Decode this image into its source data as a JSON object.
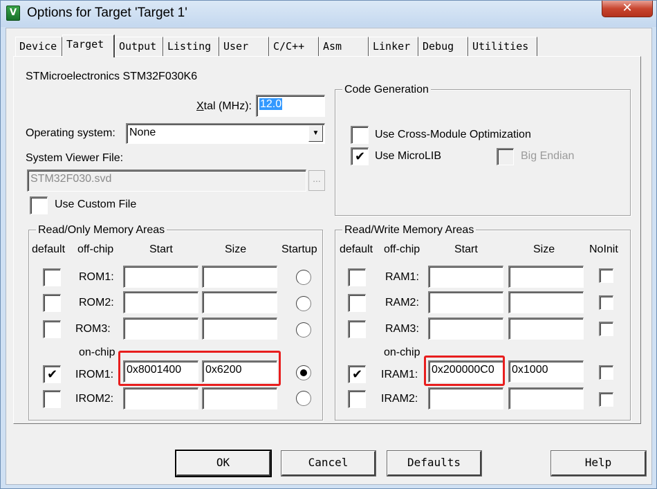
{
  "window": {
    "title": "Options for Target 'Target 1'",
    "icon": "keil-uvision-icon",
    "close_glyph": "✕"
  },
  "tabs": [
    {
      "label": "Device",
      "active": false
    },
    {
      "label": "Target",
      "active": true
    },
    {
      "label": "Output",
      "active": false
    },
    {
      "label": "Listing",
      "active": false
    },
    {
      "label": "User",
      "active": false
    },
    {
      "label": "C/C++",
      "active": false
    },
    {
      "label": "Asm",
      "active": false
    },
    {
      "label": "Linker",
      "active": false
    },
    {
      "label": "Debug",
      "active": false
    },
    {
      "label": "Utilities",
      "active": false
    }
  ],
  "device_name": "STMicroelectronics STM32F030K6",
  "xtal": {
    "label_pre": "",
    "label_u": "X",
    "label_post": "tal (MHz):",
    "value": "12.0"
  },
  "os": {
    "label": "Operating system:",
    "value": "None",
    "arrow": "▼"
  },
  "svd": {
    "label": "System Viewer File:",
    "value": "STM32F030.svd",
    "browse": "..."
  },
  "custom_file": {
    "label": "Use Custom File",
    "checked": false
  },
  "code_gen": {
    "title": "Code Generation",
    "cross_module": {
      "label": "Use Cross-Module Optimization",
      "checked": false
    },
    "microlib": {
      "label": "Use MicroLIB",
      "checked": true,
      "check_glyph": "✔"
    },
    "big_endian": {
      "label_pre": "Bi",
      "label_u": "g",
      "label_post": " Endian",
      "checked": false
    }
  },
  "ro": {
    "title": "Read/Only Memory Areas",
    "headers": {
      "default": "default",
      "offchip": "off-chip",
      "start": "Start",
      "size": "Size",
      "startup": "Startup"
    },
    "onchip_label": "on-chip",
    "rows": [
      {
        "name": "ROM1:",
        "default": false,
        "start": "",
        "size": "",
        "startup": false
      },
      {
        "name": "ROM2:",
        "default": false,
        "start": "",
        "size": "",
        "startup": false
      },
      {
        "name": "ROM3:",
        "default": false,
        "start": "",
        "size": "",
        "startup": false
      },
      {
        "name": "IROM1:",
        "default": true,
        "start": "0x8001400",
        "size": "0x6200",
        "startup": true
      },
      {
        "name": "IROM2:",
        "default": false,
        "start": "",
        "size": "",
        "startup": false
      }
    ]
  },
  "rw": {
    "title": "Read/Write Memory Areas",
    "headers": {
      "default": "default",
      "offchip": "off-chip",
      "start": "Start",
      "size": "Size",
      "noinit": "NoInit"
    },
    "onchip_label": "on-chip",
    "rows": [
      {
        "name": "RAM1:",
        "default": false,
        "start": "",
        "size": "",
        "noinit": false
      },
      {
        "name": "RAM2:",
        "default": false,
        "start": "",
        "size": "",
        "noinit": false
      },
      {
        "name": "RAM3:",
        "default": false,
        "start": "",
        "size": "",
        "noinit": false
      },
      {
        "name": "IRAM1:",
        "default": true,
        "start": "0x200000C0",
        "size": "0x1000",
        "noinit": false
      },
      {
        "name": "IRAM2:",
        "default": false,
        "start": "",
        "size": "",
        "noinit": false
      }
    ]
  },
  "check_glyph": "✔",
  "buttons": {
    "ok": "OK",
    "cancel": "Cancel",
    "defaults": "Defaults",
    "help": "Help"
  },
  "colors": {
    "highlight": "#e81e1e",
    "selection": "#3399ff",
    "title_bar": "#cfe0f3",
    "close": "#c8452f"
  }
}
